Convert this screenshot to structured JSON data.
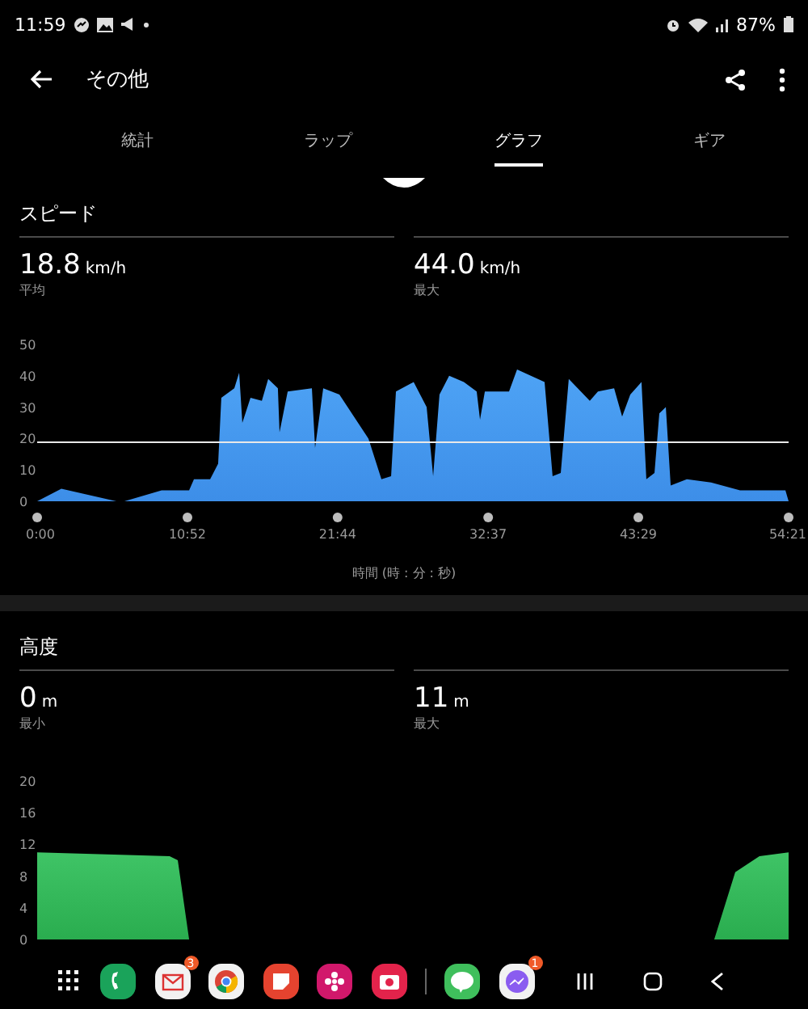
{
  "status_bar": {
    "time": "11:59",
    "battery": "87%"
  },
  "app_bar": {
    "title": "その他"
  },
  "tabs": [
    {
      "label": "統計",
      "selected": false
    },
    {
      "label": "ラップ",
      "selected": false
    },
    {
      "label": "グラフ",
      "selected": true
    },
    {
      "label": "ギア",
      "selected": false
    }
  ],
  "sections": [
    {
      "title": "スピード",
      "stats": [
        {
          "value": "18.8",
          "unit": "km/h",
          "label": "平均"
        },
        {
          "value": "44.0",
          "unit": "km/h",
          "label": "最大"
        }
      ],
      "chart_data": {
        "type": "area",
        "xlabel": "時間 (時 : 分 : 秒)",
        "x": [
          0,
          1.75,
          5.73,
          6.31,
          9.0,
          10.99,
          11.34,
          12.51,
          13.09,
          13.32,
          14.26,
          14.61,
          14.84,
          15.43,
          16.25,
          16.71,
          17.41,
          17.53,
          18.12,
          19.87,
          20.1,
          20.69,
          21.86,
          23.96,
          24.9,
          25.6,
          25.95,
          27.23,
          28.17,
          28.64,
          29.1,
          29.8,
          30.86,
          31.79,
          32.03,
          32.38,
          34.13,
          34.71,
          36.7,
          37.28,
          37.87,
          38.45,
          39.97,
          40.56,
          41.73,
          42.31,
          42.9,
          43.71,
          44.06,
          44.65,
          45.0,
          45.47,
          45.82,
          46.99,
          48.74,
          50.84,
          54.12,
          54.35
        ],
        "series": [
          {
            "color": "#3d8ee8",
            "values": [
              0,
              4,
              0,
              0,
              3.5,
              3.5,
              7,
              7,
              12,
              33,
              36,
              41,
              25,
              33,
              32,
              39,
              36,
              22,
              35,
              36,
              17,
              36,
              34,
              20,
              7,
              8,
              35,
              38,
              30,
              8,
              34,
              40,
              38,
              35,
              26,
              35,
              35,
              42,
              38,
              8,
              9,
              39,
              32,
              35,
              36,
              27,
              34,
              38,
              7,
              9,
              28,
              30,
              5,
              7,
              6,
              3.5,
              3.5,
              0
            ]
          }
        ],
        "xlim": [
          0,
          54.35
        ],
        "ylim": [
          0,
          50
        ],
        "xticks": [
          {
            "value": 0,
            "label": "0:00"
          },
          {
            "value": 10.87,
            "label": "10:52"
          },
          {
            "value": 21.73,
            "label": "21:44"
          },
          {
            "value": 32.62,
            "label": "32:37"
          },
          {
            "value": 43.48,
            "label": "43:29"
          },
          {
            "value": 54.35,
            "label": "54:21"
          }
        ],
        "yticks": [
          0,
          10,
          20,
          30,
          40,
          50
        ],
        "ref_lines": [
          {
            "axis": "y",
            "value": 18.8
          }
        ]
      }
    },
    {
      "title": "高度",
      "stats": [
        {
          "value": "0",
          "unit": "m",
          "label": "最小"
        },
        {
          "value": "11",
          "unit": "m",
          "label": "最大"
        }
      ],
      "chart_data": {
        "type": "area",
        "x": [
          0,
          9.58,
          10.17,
          10.99,
          48.97,
          50.49,
          52.24,
          54.35
        ],
        "series": [
          {
            "color": "#2aad4f",
            "values": [
              11,
              10.5,
              10,
              0,
              0,
              8.5,
              10.5,
              11
            ]
          }
        ],
        "xlim": [
          0,
          54.35
        ],
        "ylim": [
          0,
          20
        ],
        "yticks": [
          0,
          4,
          8,
          12,
          16,
          20
        ]
      }
    }
  ],
  "taskbar": {
    "apps": [
      {
        "kind": "grid"
      },
      {
        "kind": "phone"
      },
      {
        "kind": "mail",
        "badge": "3"
      },
      {
        "kind": "chrome"
      },
      {
        "kind": "notes"
      },
      {
        "kind": "flower"
      },
      {
        "kind": "camera"
      },
      {
        "kind": "divider"
      },
      {
        "kind": "chat"
      },
      {
        "kind": "messenger",
        "badge": "1"
      }
    ]
  }
}
